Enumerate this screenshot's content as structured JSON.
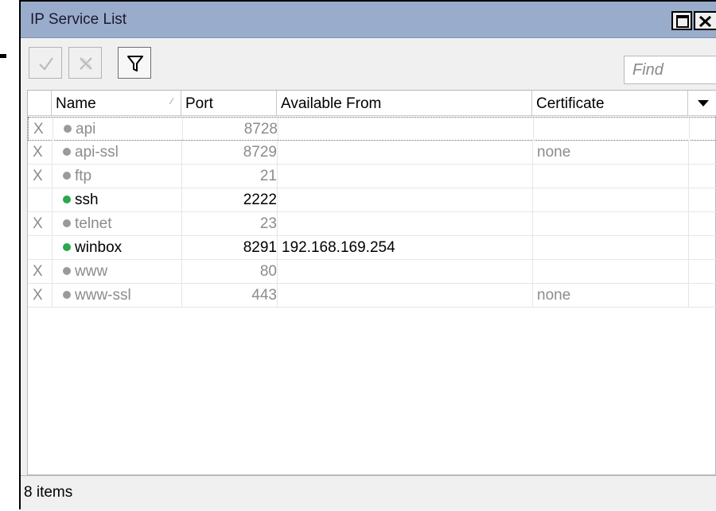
{
  "window": {
    "title": "IP Service List"
  },
  "toolbar": {
    "enable_icon": "check-icon",
    "disable_icon": "x-icon",
    "filter_icon": "filter-icon",
    "find_placeholder": "Find"
  },
  "table": {
    "columns": [
      {
        "label": ""
      },
      {
        "label": "Name"
      },
      {
        "label": "Port"
      },
      {
        "label": "Available From"
      },
      {
        "label": "Certificate"
      }
    ],
    "rows": [
      {
        "flag": "X",
        "name": "api",
        "port": "8728",
        "available_from": "",
        "certificate": "",
        "enabled": false
      },
      {
        "flag": "X",
        "name": "api-ssl",
        "port": "8729",
        "available_from": "",
        "certificate": "none",
        "enabled": false
      },
      {
        "flag": "X",
        "name": "ftp",
        "port": "21",
        "available_from": "",
        "certificate": "",
        "enabled": false
      },
      {
        "flag": "",
        "name": "ssh",
        "port": "2222",
        "available_from": "",
        "certificate": "",
        "enabled": true
      },
      {
        "flag": "X",
        "name": "telnet",
        "port": "23",
        "available_from": "",
        "certificate": "",
        "enabled": false
      },
      {
        "flag": "",
        "name": "winbox",
        "port": "8291",
        "available_from": "192.168.169.254",
        "certificate": "",
        "enabled": true
      },
      {
        "flag": "X",
        "name": "www",
        "port": "80",
        "available_from": "",
        "certificate": "",
        "enabled": false
      },
      {
        "flag": "X",
        "name": "www-ssl",
        "port": "443",
        "available_from": "",
        "certificate": "none",
        "enabled": false
      }
    ]
  },
  "status": {
    "count_text": "8 items"
  },
  "colors": {
    "titlebar": "#9aaccc",
    "enabled_dot": "#2aa84a",
    "disabled_dot": "#9a9a9a",
    "disabled_text": "#8c8c8c"
  }
}
